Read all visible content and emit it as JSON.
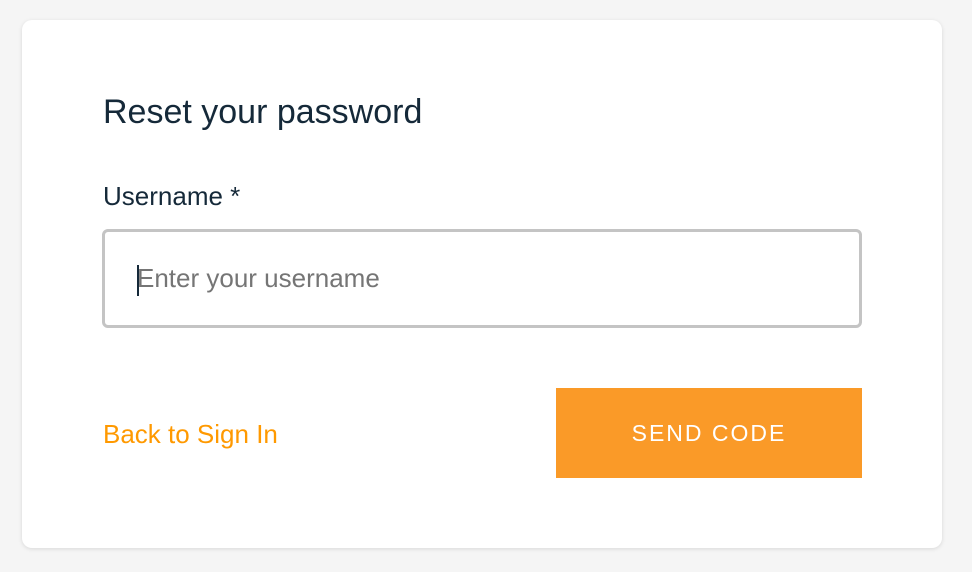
{
  "form": {
    "title": "Reset your password",
    "username_label": "Username *",
    "username_value": "",
    "username_placeholder": "Enter your username",
    "back_link_label": "Back to Sign In",
    "submit_label": "SEND CODE"
  },
  "colors": {
    "accent": "#fa9a28",
    "link": "#ff9900",
    "text": "#152939",
    "input_border": "#c4c4c4",
    "background": "#f5f5f5",
    "card": "#ffffff"
  }
}
